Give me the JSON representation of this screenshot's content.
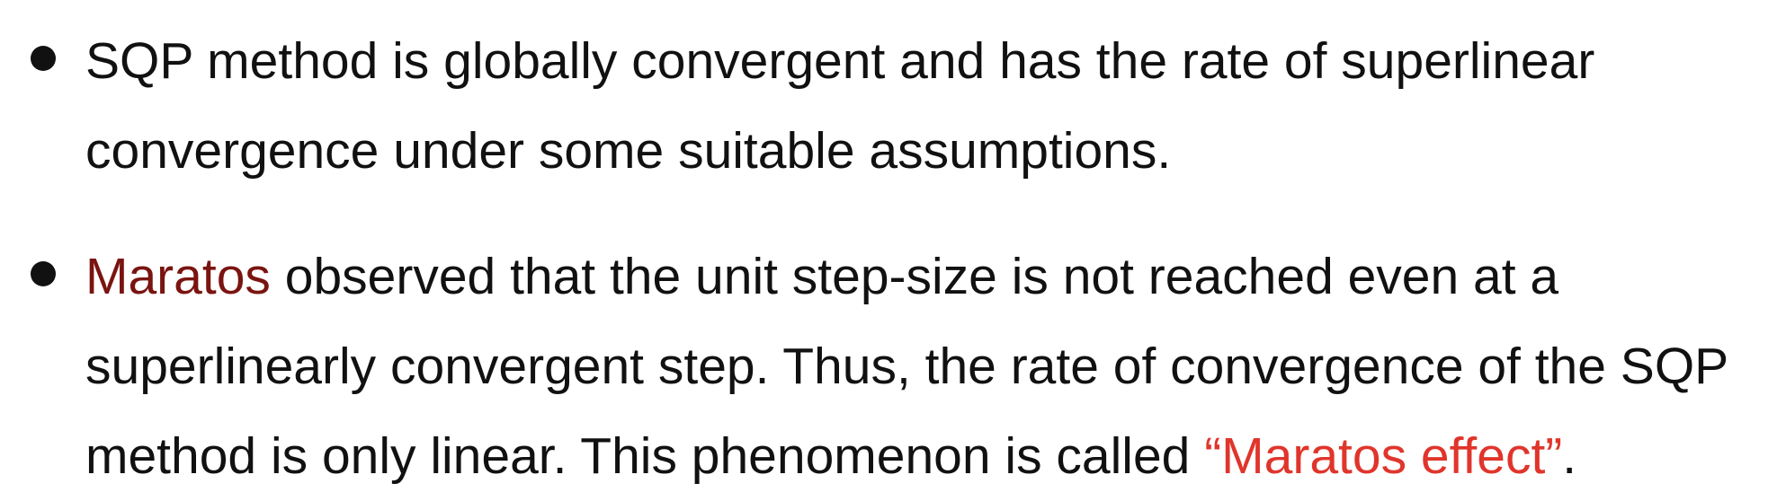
{
  "bullets": [
    {
      "lines": [
        "SQP method is globally convergent and has the rate of superlinear",
        "convergence under some suitable assumptions."
      ]
    },
    {
      "line1_highlight": "Maratos",
      "line1_rest": " observed that the unit step-size is not reached even at a",
      "line2": "superlinearly convergent step. Thus, the rate of convergence of the SQP",
      "line3_prefix": "method is only linear. This phenomenon is called ",
      "line3_highlight": "“Maratos effect”",
      "line3_suffix": "."
    }
  ],
  "colors": {
    "text": "#111111",
    "name_highlight": "#7a1410",
    "term_highlight": "#e0352b"
  }
}
